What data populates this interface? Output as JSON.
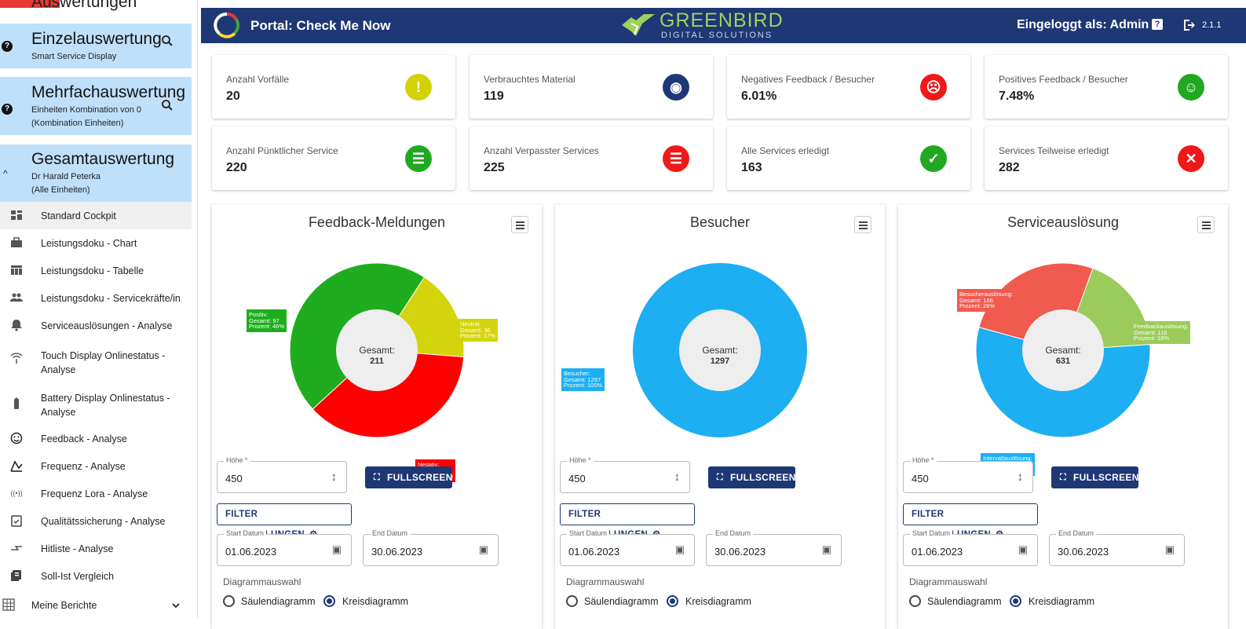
{
  "sidebar": {
    "top_title": "Auswertungen",
    "einzel": {
      "title": "Einzelauswertung",
      "sub": "Smart Service Display"
    },
    "mehrfach": {
      "title": "Mehrfachauswertung",
      "sub1": "Einheiten Kombination von 0",
      "sub2": "(Kombination Einheiten)"
    },
    "gesamt": {
      "title": "Gesamtauswertung",
      "sub1": "Dr Harald Peterka",
      "sub2": "(Alle Einheiten)"
    },
    "items": [
      {
        "label": "Standard Cockpit",
        "icon": "dashboard-icon"
      },
      {
        "label": "Leistungsdoku - Chart",
        "icon": "briefcase-icon"
      },
      {
        "label": "Leistungsdoku - Tabelle",
        "icon": "table-icon"
      },
      {
        "label": "Leistungsdoku - Servicekräfte/in",
        "icon": "people-icon"
      },
      {
        "label": "Serviceauslösungen - Analyse",
        "icon": "bell-icon"
      },
      {
        "label": "Touch Display Onlinestatus - Analyse",
        "icon": "wifi-icon"
      },
      {
        "label": "Battery Display Onlinestatus - Analyse",
        "icon": "battery-icon"
      },
      {
        "label": "Feedback - Analyse",
        "icon": "smiley-icon"
      },
      {
        "label": "Frequenz - Analyse",
        "icon": "chart-line-icon"
      },
      {
        "label": "Frequenz Lora - Analyse",
        "icon": "signal-icon"
      },
      {
        "label": "Qualitätssicherung - Analyse",
        "icon": "clipboard-icon"
      },
      {
        "label": "Hitliste - Analyse",
        "icon": "arrows-icon"
      },
      {
        "label": "Soll-Ist Vergleich",
        "icon": "compare-icon"
      }
    ],
    "reports": {
      "label": "Meine Berichte",
      "icon": "grid-icon"
    }
  },
  "header": {
    "portal": "Portal: Check Me Now",
    "brand": "GREENBIRD",
    "brand_sub": "DIGITAL SOLUTIONS",
    "user": "Eingeloggt als: Admin",
    "version": "2.1.1"
  },
  "kpis": [
    {
      "label": "Anzahl Vorfälle",
      "value": "20",
      "icon": "warning-icon",
      "color": "#d4d100"
    },
    {
      "label": "Verbrauchtes Material",
      "value": "119",
      "icon": "toilet-paper-icon",
      "color": "#1e3775"
    },
    {
      "label": "Negatives Feedback / Besucher",
      "value": "6.01%",
      "icon": "sad-face-icon",
      "color": "#f01818"
    },
    {
      "label": "Positives Feedback / Besucher",
      "value": "7.48%",
      "icon": "happy-face-icon",
      "color": "#20a820"
    },
    {
      "label": "Anzahl Pünktlicher Service",
      "value": "220",
      "icon": "checklist-icon",
      "color": "#20a820"
    },
    {
      "label": "Anzahl Verpasster Services",
      "value": "225",
      "icon": "checklist-icon",
      "color": "#f01818"
    },
    {
      "label": "Alle Services erledigt",
      "value": "163",
      "icon": "check-circle-icon",
      "color": "#20a820"
    },
    {
      "label": "Services Teilweise erledigt",
      "value": "282",
      "icon": "x-circle-icon",
      "color": "#f01818"
    }
  ],
  "controls": {
    "hoehe_label": "Höhe *",
    "hoehe_value": "450",
    "fullscreen": "FULLSCREEN",
    "filter": "FILTER EINSTELLUNGEN",
    "start_label": "Start Datum",
    "start_value": "01.06.2023",
    "end_label": "End Datum",
    "end_value": "30.06.2023",
    "diagram_label": "Diagrammauswahl",
    "opt_bar": "Säulendiagramm",
    "opt_pie": "Kreisdiagramm"
  },
  "chart_data": [
    {
      "type": "pie",
      "title": "Feedback-Meldungen",
      "center_label": "Gesamt:",
      "center_value": "211",
      "slices": [
        {
          "name": "Neutral",
          "value": 36,
          "percent": 17,
          "color": "#d4d40c",
          "lines": [
            "Neutral:",
            "Gesamt: 36",
            "Prozent: 17%"
          ]
        },
        {
          "name": "Negativ",
          "value": 78,
          "percent": 37,
          "color": "#ff0000",
          "lines": [
            "Negativ:",
            "Gesamt: 78",
            "Prozent: 37%"
          ]
        },
        {
          "name": "Positiv",
          "value": 97,
          "percent": 46,
          "color": "#1fad1f",
          "lines": [
            "Positiv:",
            "Gesamt: 97",
            "Prozent: 46%"
          ]
        }
      ]
    },
    {
      "type": "pie",
      "title": "Besucher",
      "center_label": "Gesamt:",
      "center_value": "1297",
      "slices": [
        {
          "name": "Besucher",
          "value": 1297,
          "percent": 100,
          "color": "#1eaef2",
          "lines": [
            "Besucher:",
            "Gesamt: 1297",
            "Prozent: 100%"
          ]
        }
      ]
    },
    {
      "type": "pie",
      "title": "Serviceauslösung",
      "center_label": "Gesamt:",
      "center_value": "631",
      "slices": [
        {
          "name": "Feedbackauslösung",
          "value": 116,
          "percent": 18,
          "color": "#9bcb5b",
          "lines": [
            "Feedbackauslösung:",
            "Gesamt: 116",
            "Prozent: 18%"
          ]
        },
        {
          "name": "Intervallauslösung",
          "value": 349,
          "percent": 55,
          "color": "#1eaef2",
          "lines": [
            "Intervallauslösung:",
            "Gesamt: 349",
            "Prozent: 55%"
          ]
        },
        {
          "name": "Besucherauslösung",
          "value": 166,
          "percent": 26,
          "color": "#f05a4f",
          "lines": [
            "Besucherauslösung:",
            "Gesamt: 166",
            "Prozent: 26%"
          ]
        }
      ]
    }
  ]
}
